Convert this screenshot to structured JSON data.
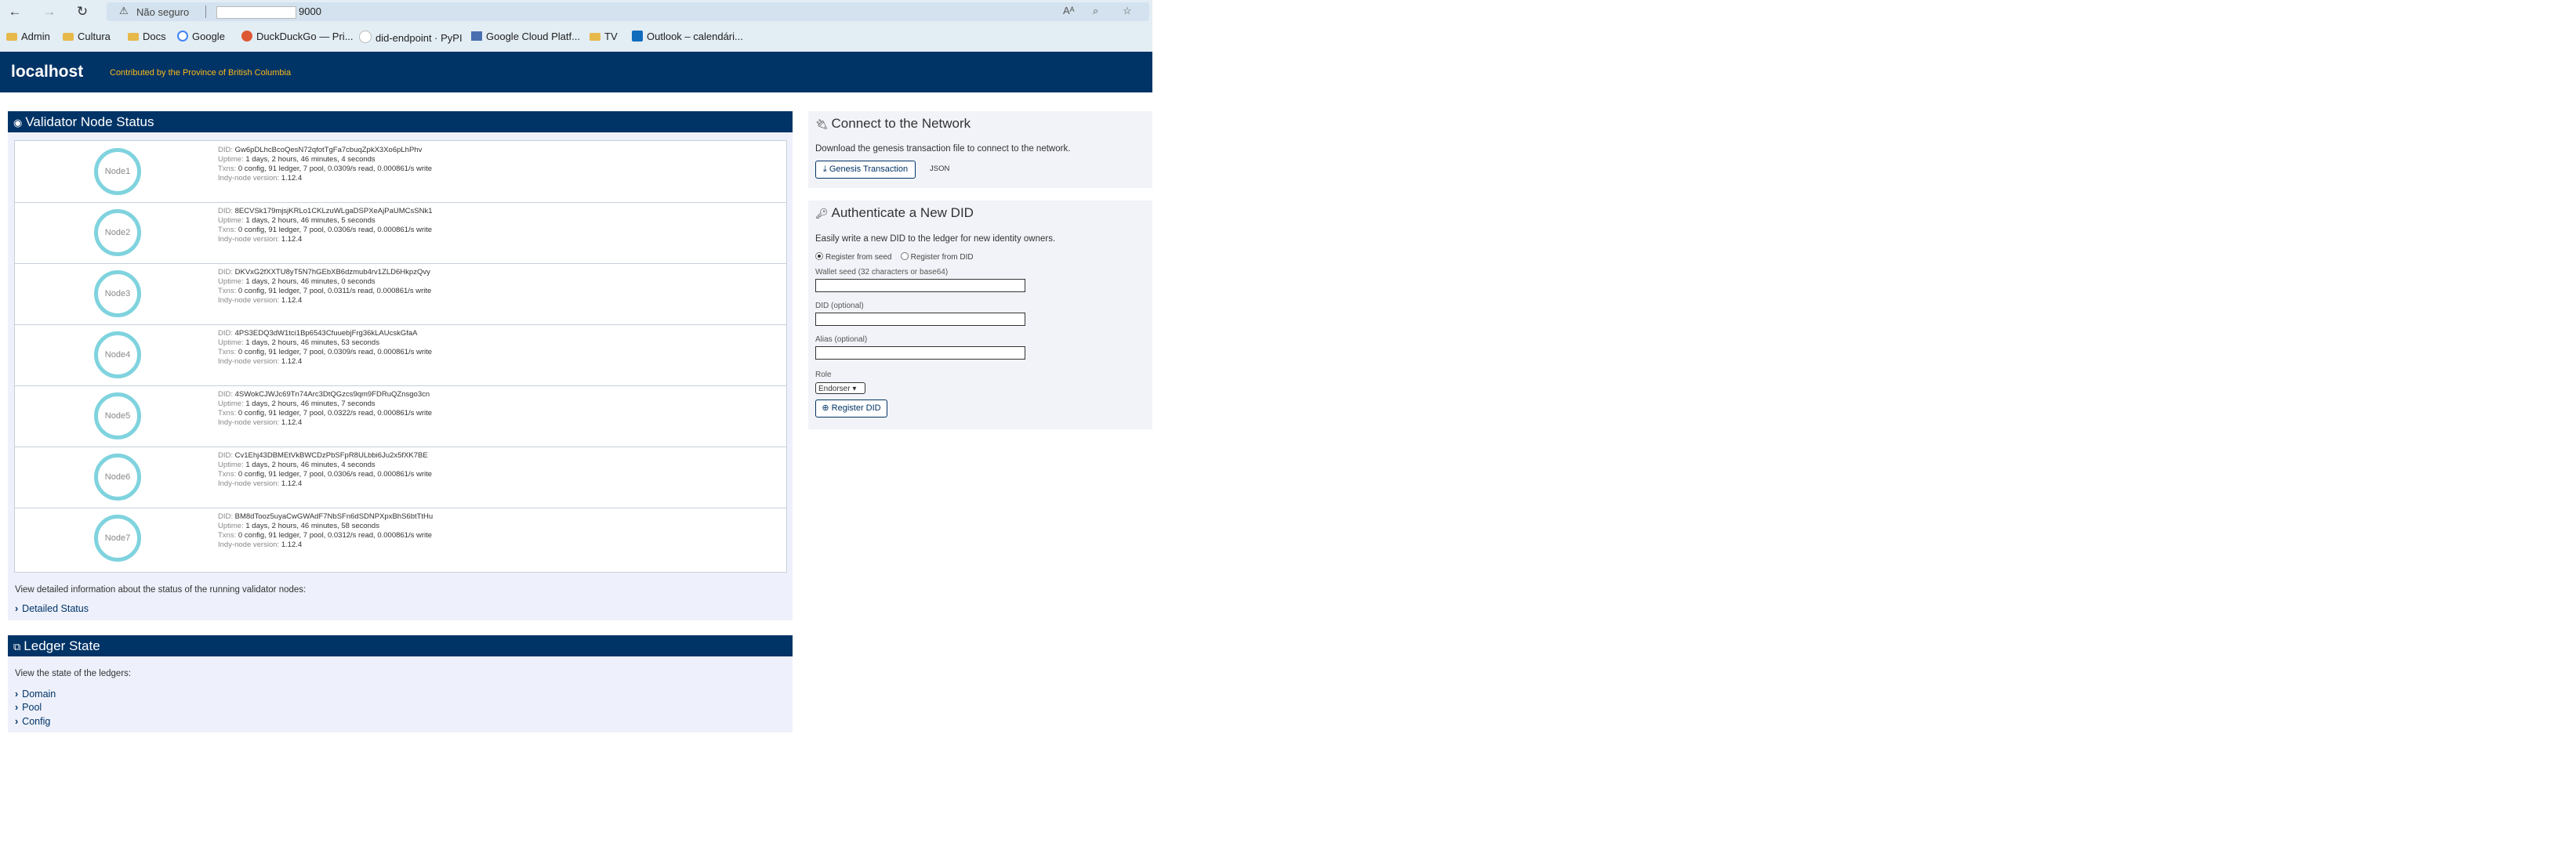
{
  "browser": {
    "not_secure": "Não seguro",
    "url": "9000",
    "bookmarks": [
      {
        "label": "Admin",
        "icon": "folder-icon"
      },
      {
        "label": "Cultura",
        "icon": "folder-icon"
      },
      {
        "label": "Docs",
        "icon": "folder-icon"
      },
      {
        "label": "Google",
        "icon": "google-icon"
      },
      {
        "label": "DuckDuckGo — Pri...",
        "icon": "duckduckgo-icon"
      },
      {
        "label": "did-endpoint · PyPI",
        "icon": "pypi-icon"
      },
      {
        "label": "Google Cloud Platf...",
        "icon": "gcp-icon"
      },
      {
        "label": "TV",
        "icon": "folder-icon"
      },
      {
        "label": "Outlook – calendári...",
        "icon": "outlook-icon"
      }
    ]
  },
  "app": {
    "brand": "localhost",
    "tagline": "Contributed by the Province of British Columbia"
  },
  "validator": {
    "title": "Validator Node Status",
    "labels": {
      "did": "DID:",
      "uptime": "Uptime:",
      "txns": "Txns:",
      "version": "Indy-node version:"
    },
    "nodes": [
      {
        "name": "Node1",
        "did": "Gw6pDLhcBcoQesN72qfotTgFa7cbuqZpkX3Xo6pLhPhv",
        "uptime": "1 days, 2 hours, 46 minutes, 4 seconds",
        "txns": "0 config, 91 ledger, 7 pool, 0.0309/s read, 0.000861/s write",
        "version": "1.12.4"
      },
      {
        "name": "Node2",
        "did": "8ECVSk179mjsjKRLo1CKLzuWLgaDSPXeAjPaUMCsSNk1",
        "uptime": "1 days, 2 hours, 46 minutes, 5 seconds",
        "txns": "0 config, 91 ledger, 7 pool, 0.0306/s read, 0.000861/s write",
        "version": "1.12.4"
      },
      {
        "name": "Node3",
        "did": "DKVxG2fXXTU8yT5N7hGEbXB6dzmub4rv1ZLD6HkpzQvy",
        "uptime": "1 days, 2 hours, 46 minutes, 0 seconds",
        "txns": "0 config, 91 ledger, 7 pool, 0.0311/s read, 0.000861/s write",
        "version": "1.12.4"
      },
      {
        "name": "Node4",
        "did": "4PS3EDQ3dW1tci1Bp6543CfuuebjFrg36kLAUcskGfaA",
        "uptime": "1 days, 2 hours, 46 minutes, 53 seconds",
        "txns": "0 config, 91 ledger, 7 pool, 0.0309/s read, 0.000861/s write",
        "version": "1.12.4"
      },
      {
        "name": "Node5",
        "did": "4SWokCJWJc69Tn74Arc3DtQGzcs9qm9FDRuQZnsgo3cn",
        "uptime": "1 days, 2 hours, 46 minutes, 7 seconds",
        "txns": "0 config, 91 ledger, 7 pool, 0.0322/s read, 0.000861/s write",
        "version": "1.12.4"
      },
      {
        "name": "Node6",
        "did": "Cv1Ehj43DBMEtVkBWCDzPbSFpR8ULbbi6Ju2x5fXK7BE",
        "uptime": "1 days, 2 hours, 46 minutes, 4 seconds",
        "txns": "0 config, 91 ledger, 7 pool, 0.0306/s read, 0.000861/s write",
        "version": "1.12.4"
      },
      {
        "name": "Node7",
        "did": "BM8dTooz5uyaCwGWAdF7NbSFn6dSDNPXpxBhS6btTtHu",
        "uptime": "1 days, 2 hours, 46 minutes, 58 seconds",
        "txns": "0 config, 91 ledger, 7 pool, 0.0312/s read, 0.000861/s write",
        "version": "1.12.4"
      }
    ],
    "note": "View detailed information about the status of the running validator nodes:",
    "detailed_link": "Detailed Status"
  },
  "ledger": {
    "title": "Ledger State",
    "note": "View the state of the ledgers:",
    "links": [
      "Domain",
      "Pool",
      "Config"
    ]
  },
  "connect": {
    "title": "Connect to the Network",
    "text": "Download the genesis transaction file to connect to the network.",
    "genesis_button": "Genesis Transaction",
    "json_link": "JSON"
  },
  "auth": {
    "title": "Authenticate a New DID",
    "text": "Easily write a new DID to the ledger for new identity owners.",
    "radio_seed": "Register from seed",
    "radio_did": "Register from DID",
    "wallet_seed_label": "Wallet seed (32 characters or base64)",
    "did_label": "DID (optional)",
    "alias_label": "Alias (optional)",
    "role_label": "Role",
    "role_value": "Endorser",
    "register_button": "Register DID"
  },
  "colors": {
    "header": "#003366",
    "accent": "#fcba19",
    "ring": "#7fd3de"
  }
}
